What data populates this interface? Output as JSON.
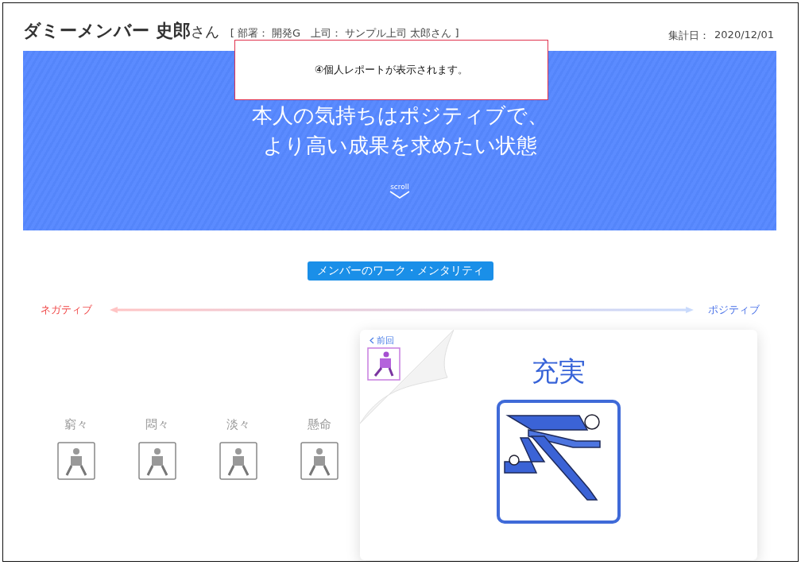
{
  "header": {
    "name": "ダミーメンバー 史郎",
    "honorific": "さん",
    "meta": "[ 部署： 開発G　上司： サンプル上司 太郎さん ]",
    "date_label": "集計日：",
    "date": "2020/12/01"
  },
  "banner": {
    "lines": [
      "本人の気持ちはポジティブで、",
      "より高い成果を求めたい状態"
    ],
    "scroll_label": "scroll"
  },
  "notice": {
    "text": "④個人レポートが表示されます。"
  },
  "section_title": "メンバーのワーク・メンタリティ",
  "scale": {
    "negative": "ネガティブ",
    "positive": "ポジティブ"
  },
  "moods": [
    {
      "label": "窮々"
    },
    {
      "label": "悶々"
    },
    {
      "label": "淡々"
    },
    {
      "label": "懸命"
    }
  ],
  "card": {
    "previous_link": "前回",
    "state": "充実"
  }
}
